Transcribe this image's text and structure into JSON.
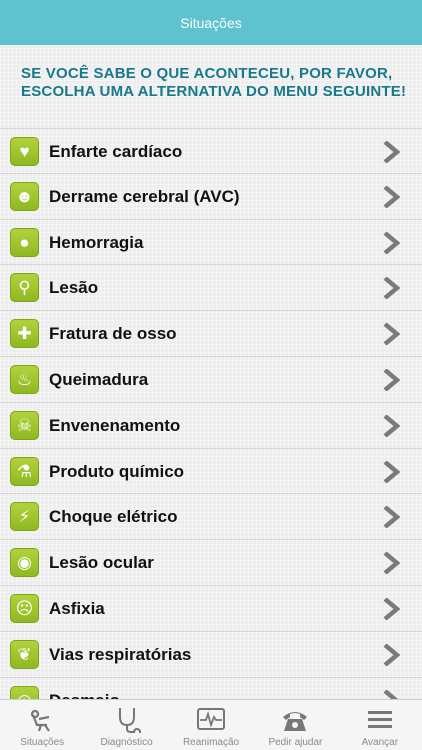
{
  "nav": {
    "title": "Situações"
  },
  "intro": "SE VOCÊ SABE O QUE ACONTECEU, POR FAVOR, ESCOLHA UMA ALTERNATIVA DO MENU SEGUINTE!",
  "colors": {
    "header": "#5ec2cf",
    "intro_text": "#17798b",
    "icon_green": "#9dc42c",
    "chevron": "#7a7a7a"
  },
  "items": [
    {
      "label": "Enfarte cardíaco",
      "icon": "broken-heart-icon"
    },
    {
      "label": "Derrame cerebral (AVC)",
      "icon": "head-icon"
    },
    {
      "label": "Hemorragia",
      "icon": "blood-drop-icon"
    },
    {
      "label": "Lesão",
      "icon": "injured-person-icon"
    },
    {
      "label": "Fratura de osso",
      "icon": "bone-icon"
    },
    {
      "label": "Queimadura",
      "icon": "flame-icon"
    },
    {
      "label": "Envenenamento",
      "icon": "skull-icon"
    },
    {
      "label": "Produto químico",
      "icon": "chemical-icon"
    },
    {
      "label": "Choque elétrico",
      "icon": "lightning-icon"
    },
    {
      "label": "Lesão ocular",
      "icon": "eye-icon"
    },
    {
      "label": "Asfixia",
      "icon": "choking-icon"
    },
    {
      "label": "Vias respiratórias",
      "icon": "lungs-icon"
    },
    {
      "label": "Desmaio",
      "icon": "spiral-icon"
    }
  ],
  "tabs": [
    {
      "label": "Situações",
      "icon": "patient-icon"
    },
    {
      "label": "Diagnóstico",
      "icon": "stethoscope-icon"
    },
    {
      "label": "Reanimação",
      "icon": "ekg-monitor-icon"
    },
    {
      "label": "Pedir ajudar",
      "icon": "telephone-icon"
    },
    {
      "label": "Avançar",
      "icon": "menu-icon"
    }
  ]
}
